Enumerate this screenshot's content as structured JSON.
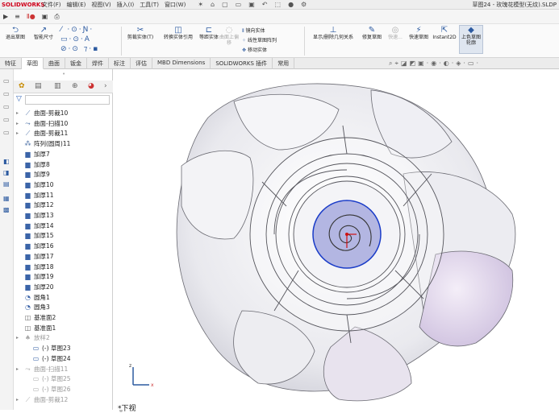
{
  "app": {
    "brand": "SOLIDWORKS",
    "title": "草图24 - 玫瑰花模型(无纹).SLDP"
  },
  "menus": [
    "文件(F)",
    "编辑(E)",
    "视图(V)",
    "插入(I)",
    "工具(T)",
    "窗口(W)"
  ],
  "cmd": {
    "exit_sketch": "退出草图",
    "smart_dim": "智能尺寸",
    "trim": "剪裁实体(T)",
    "convert": "转换实体引用",
    "offset": "等距实体",
    "surface_offset": "曲面上偏移",
    "mirror": "镜向实体",
    "linear_pattern": "线性草图阵列",
    "move": "移动实体",
    "show_relations": "显示/删除几何关系",
    "repair": "修复草图",
    "quick_snaps": "快速...",
    "rapid": "快速草图",
    "instant2d": "Instant2D",
    "shaded": "上色草图轮廓"
  },
  "tabs": [
    "特征",
    "草图",
    "曲面",
    "钣金",
    "焊件",
    "标注",
    "评估",
    "MBD Dimensions",
    "SOLIDWORKS 插件",
    "常用"
  ],
  "tree": [
    {
      "label": "曲面-剪裁10",
      "icon": "surface-trim-icon",
      "dim": false,
      "exp": true
    },
    {
      "label": "曲面-扫描10",
      "icon": "surface-sweep-icon",
      "dim": false,
      "exp": true
    },
    {
      "label": "曲面-剪裁11",
      "icon": "surface-trim-icon",
      "dim": false,
      "exp": true
    },
    {
      "label": "阵列(圆周)11",
      "icon": "circular-pattern-icon",
      "dim": false,
      "exp": false
    },
    {
      "label": "加厚7",
      "icon": "thicken-icon",
      "dim": false,
      "exp": false
    },
    {
      "label": "加厚8",
      "icon": "thicken-icon",
      "dim": false,
      "exp": false
    },
    {
      "label": "加厚9",
      "icon": "thicken-icon",
      "dim": false,
      "exp": false
    },
    {
      "label": "加厚10",
      "icon": "thicken-icon",
      "dim": false,
      "exp": false
    },
    {
      "label": "加厚11",
      "icon": "thicken-icon",
      "dim": false,
      "exp": false
    },
    {
      "label": "加厚12",
      "icon": "thicken-icon",
      "dim": false,
      "exp": false
    },
    {
      "label": "加厚13",
      "icon": "thicken-icon",
      "dim": false,
      "exp": false
    },
    {
      "label": "加厚14",
      "icon": "thicken-icon",
      "dim": false,
      "exp": false
    },
    {
      "label": "加厚15",
      "icon": "thicken-icon",
      "dim": false,
      "exp": false
    },
    {
      "label": "加厚16",
      "icon": "thicken-icon",
      "dim": false,
      "exp": false
    },
    {
      "label": "加厚17",
      "icon": "thicken-icon",
      "dim": false,
      "exp": false
    },
    {
      "label": "加厚18",
      "icon": "thicken-icon",
      "dim": false,
      "exp": false
    },
    {
      "label": "加厚19",
      "icon": "thicken-icon",
      "dim": false,
      "exp": false
    },
    {
      "label": "加厚20",
      "icon": "thicken-icon",
      "dim": false,
      "exp": false
    },
    {
      "label": "圆角1",
      "icon": "fillet-icon",
      "dim": false,
      "exp": false
    },
    {
      "label": "圆角3",
      "icon": "fillet-icon",
      "dim": false,
      "exp": false
    },
    {
      "label": "基准面2",
      "icon": "plane-icon",
      "dim": false,
      "exp": false
    },
    {
      "label": "基准面1",
      "icon": "plane-icon",
      "dim": false,
      "exp": false
    },
    {
      "label": "放样2",
      "icon": "loft-icon",
      "dim": true,
      "exp": true
    },
    {
      "label": "(-) 草图23",
      "icon": "sketch-icon",
      "dim": false,
      "exp": false,
      "indent": true
    },
    {
      "label": "(-) 草图24",
      "icon": "sketch-icon",
      "dim": false,
      "exp": false,
      "indent": true
    },
    {
      "label": "曲面-扫描11",
      "icon": "surface-sweep-icon",
      "dim": true,
      "exp": true
    },
    {
      "label": "(-) 草图25",
      "icon": "sketch-icon",
      "dim": true,
      "exp": false,
      "indent": true
    },
    {
      "label": "(-) 草图26",
      "icon": "sketch-icon",
      "dim": true,
      "exp": false,
      "indent": true
    },
    {
      "label": "曲面-剪裁12",
      "icon": "surface-trim-icon",
      "dim": true,
      "exp": true
    }
  ],
  "view": {
    "label": "*下视"
  },
  "colors": {
    "accent": "#2c5aa0",
    "sketch": "#1a3cc8",
    "petal_shade": "#d9cfe6"
  }
}
